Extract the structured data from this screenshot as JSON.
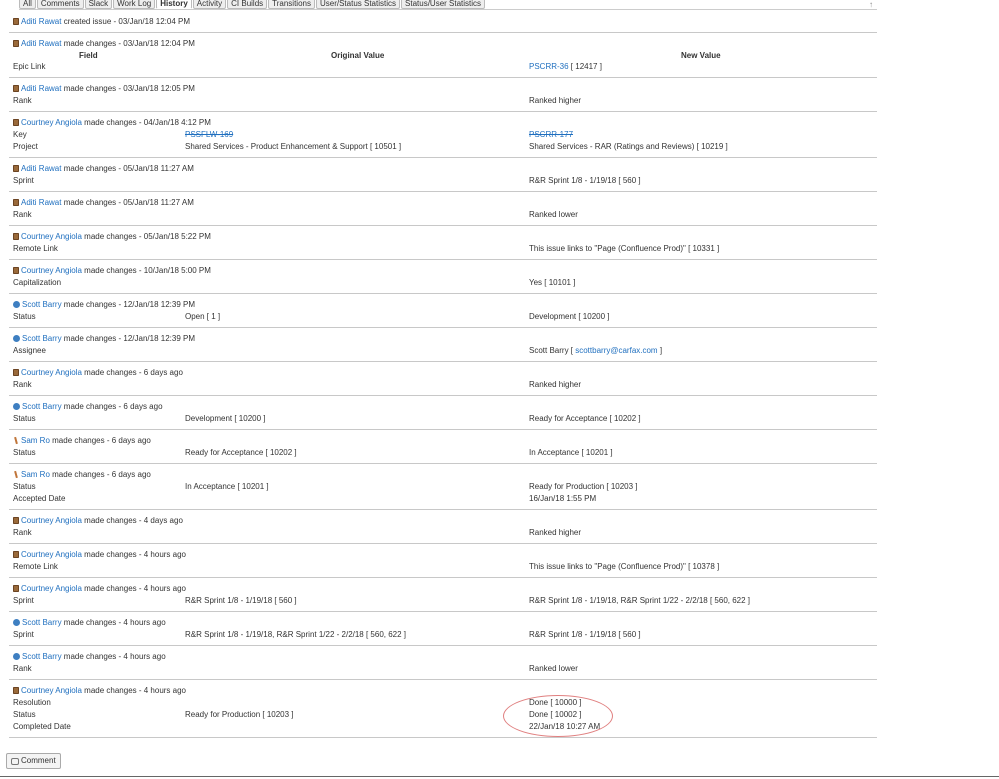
{
  "tabs": [
    {
      "label": "All",
      "active": false
    },
    {
      "label": "Comments",
      "active": false
    },
    {
      "label": "Slack",
      "active": false
    },
    {
      "label": "Work Log",
      "active": false
    },
    {
      "label": "History",
      "active": true
    },
    {
      "label": "Activity",
      "active": false
    },
    {
      "label": "CI Builds",
      "active": false
    },
    {
      "label": "Transitions",
      "active": false
    },
    {
      "label": "User/Status Statistics",
      "active": false
    },
    {
      "label": "Status/User Statistics",
      "active": false
    }
  ],
  "collapse_icon": "↑",
  "columns": {
    "field": "Field",
    "original": "Original Value",
    "new": "New Value"
  },
  "history": [
    {
      "author": "Aditi Rawat",
      "avatar": "brown",
      "action": " created issue - 03/Jan/18 12:04 PM",
      "rows": []
    },
    {
      "author": "Aditi Rawat",
      "avatar": "brown",
      "action": " made changes - 03/Jan/18 12:04 PM",
      "show_columns": true,
      "rows": [
        {
          "field": "Epic Link",
          "original": "",
          "new": "",
          "new_link": "PSCRR-36",
          "new_suffix": " [ 12417 ]"
        }
      ]
    },
    {
      "author": "Aditi Rawat",
      "avatar": "brown",
      "action": " made changes - 03/Jan/18 12:05 PM",
      "rows": [
        {
          "field": "Rank",
          "original": "",
          "new": "Ranked higher"
        }
      ]
    },
    {
      "author": "Courtney Angiola",
      "avatar": "brown",
      "action": " made changes - 04/Jan/18 4:12 PM",
      "rows": [
        {
          "field": "Key",
          "original": "",
          "orig_link": "PSSFLW-169",
          "new": "",
          "new_link": "PSCRR-177",
          "strike": true
        },
        {
          "field": "Project",
          "original": "Shared Services - Product Enhancement & Support [ 10501 ]",
          "new": "Shared Services - RAR (Ratings and Reviews) [ 10219 ]"
        }
      ]
    },
    {
      "author": "Aditi Rawat",
      "avatar": "brown",
      "action": " made changes - 05/Jan/18 11:27 AM",
      "rows": [
        {
          "field": "Sprint",
          "original": "",
          "new": "R&R Sprint 1/8 - 1/19/18 [ 560 ]"
        }
      ]
    },
    {
      "author": "Aditi Rawat",
      "avatar": "brown",
      "action": " made changes - 05/Jan/18 11:27 AM",
      "rows": [
        {
          "field": "Rank",
          "original": "",
          "new": "Ranked lower"
        }
      ]
    },
    {
      "author": "Courtney Angiola",
      "avatar": "brown",
      "action": " made changes - 05/Jan/18 5:22 PM",
      "rows": [
        {
          "field": "Remote Link",
          "original": "",
          "new": "This issue links to \"Page (Confluence Prod)\" [ 10331 ]"
        }
      ]
    },
    {
      "author": "Courtney Angiola",
      "avatar": "brown",
      "action": " made changes - 10/Jan/18 5:00 PM",
      "rows": [
        {
          "field": "Capitalization",
          "original": "",
          "new": "Yes [ 10101 ]"
        }
      ]
    },
    {
      "author": "Scott Barry",
      "avatar": "blue",
      "action": " made changes - 12/Jan/18 12:39 PM",
      "rows": [
        {
          "field": "Status",
          "original": "Open [ 1 ]",
          "new": "Development [ 10200 ]"
        }
      ]
    },
    {
      "author": "Scott Barry",
      "avatar": "blue",
      "action": " made changes - 12/Jan/18 12:39 PM",
      "rows": [
        {
          "field": "Assignee",
          "original": "",
          "new": "Scott Barry [ ",
          "new_link": "scottbarry@carfax.com",
          "new_suffix": " ]"
        }
      ]
    },
    {
      "author": "Courtney Angiola",
      "avatar": "brown",
      "action": " made changes - 6 days ago",
      "rows": [
        {
          "field": "Rank",
          "original": "",
          "new": "Ranked higher"
        }
      ]
    },
    {
      "author": "Scott Barry",
      "avatar": "blue",
      "action": " made changes - 6 days ago",
      "rows": [
        {
          "field": "Status",
          "original": "Development [ 10200 ]",
          "new": "Ready for Acceptance [ 10202 ]"
        }
      ]
    },
    {
      "author": "Sam Ro",
      "avatar": "stick",
      "action": " made changes - 6 days ago",
      "rows": [
        {
          "field": "Status",
          "original": "Ready for Acceptance [ 10202 ]",
          "new": "In Acceptance [ 10201 ]"
        }
      ]
    },
    {
      "author": "Sam Ro",
      "avatar": "stick",
      "action": " made changes - 6 days ago",
      "rows": [
        {
          "field": "Status",
          "original": "In Acceptance [ 10201 ]",
          "new": "Ready for Production [ 10203 ]"
        },
        {
          "field": "Accepted Date",
          "original": "",
          "new": "16/Jan/18 1:55 PM"
        }
      ]
    },
    {
      "author": "Courtney Angiola",
      "avatar": "brown",
      "action": " made changes - 4 days ago",
      "rows": [
        {
          "field": "Rank",
          "original": "",
          "new": "Ranked higher"
        }
      ]
    },
    {
      "author": "Courtney Angiola",
      "avatar": "brown",
      "action": " made changes - 4 hours ago",
      "rows": [
        {
          "field": "Remote Link",
          "original": "",
          "new": "This issue links to \"Page (Confluence Prod)\" [ 10378 ]"
        }
      ]
    },
    {
      "author": "Courtney Angiola",
      "avatar": "brown",
      "action": " made changes - 4 hours ago",
      "rows": [
        {
          "field": "Sprint",
          "original": "R&R Sprint 1/8 - 1/19/18 [ 560 ]",
          "new": "R&R Sprint 1/8 - 1/19/18, R&R Sprint 1/22 - 2/2/18 [ 560, 622 ]"
        }
      ]
    },
    {
      "author": "Scott Barry",
      "avatar": "blue",
      "action": " made changes - 4 hours ago",
      "rows": [
        {
          "field": "Sprint",
          "original": "R&R Sprint 1/8 - 1/19/18, R&R Sprint 1/22 - 2/2/18 [ 560, 622 ]",
          "new": "R&R Sprint 1/8 - 1/19/18 [ 560 ]"
        }
      ]
    },
    {
      "author": "Scott Barry",
      "avatar": "blue",
      "action": " made changes - 4 hours ago",
      "rows": [
        {
          "field": "Rank",
          "original": "",
          "new": "Ranked lower"
        }
      ]
    },
    {
      "author": "Courtney Angiola",
      "avatar": "brown",
      "action": " made changes - 4 hours ago",
      "highlight": true,
      "rows": [
        {
          "field": "Resolution",
          "original": "",
          "new": "Done [ 10000 ]"
        },
        {
          "field": "Status",
          "original": "Ready for Production [ 10203 ]",
          "new": "Done [ 10002 ]"
        },
        {
          "field": "Completed Date",
          "original": "",
          "new": "22/Jan/18 10:27 AM"
        }
      ]
    }
  ],
  "comment_button": "Comment"
}
